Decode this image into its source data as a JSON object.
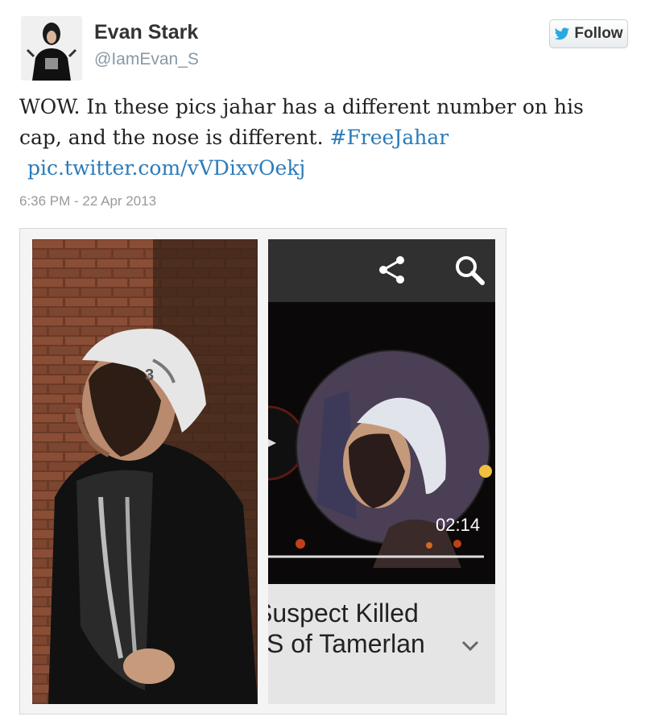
{
  "user": {
    "display_name": "Evan Stark",
    "handle": "@IamEvan_S",
    "avatar_icon": "user-avatar-photo"
  },
  "follow_button": {
    "label": "Follow",
    "icon": "twitter-bird-icon"
  },
  "tweet": {
    "text_part1": "WOW. In these pics jahar has a different number on his cap, and the nose is different.",
    "hashtag": "#FreeJahar",
    "link": "pic.twitter.com/vVDixvOekj",
    "timestamp": "6:36 PM - 22 Apr 2013"
  },
  "media": {
    "video_time": "02:14",
    "caption_line1": "Suspect Killed",
    "caption_line2": "S of Tamerlan",
    "icons": [
      "share-icon",
      "search-icon",
      "chevron-down-icon"
    ]
  },
  "colors": {
    "link": "#2b7bb9",
    "handle": "#8899a6",
    "timestamp": "#999999"
  }
}
